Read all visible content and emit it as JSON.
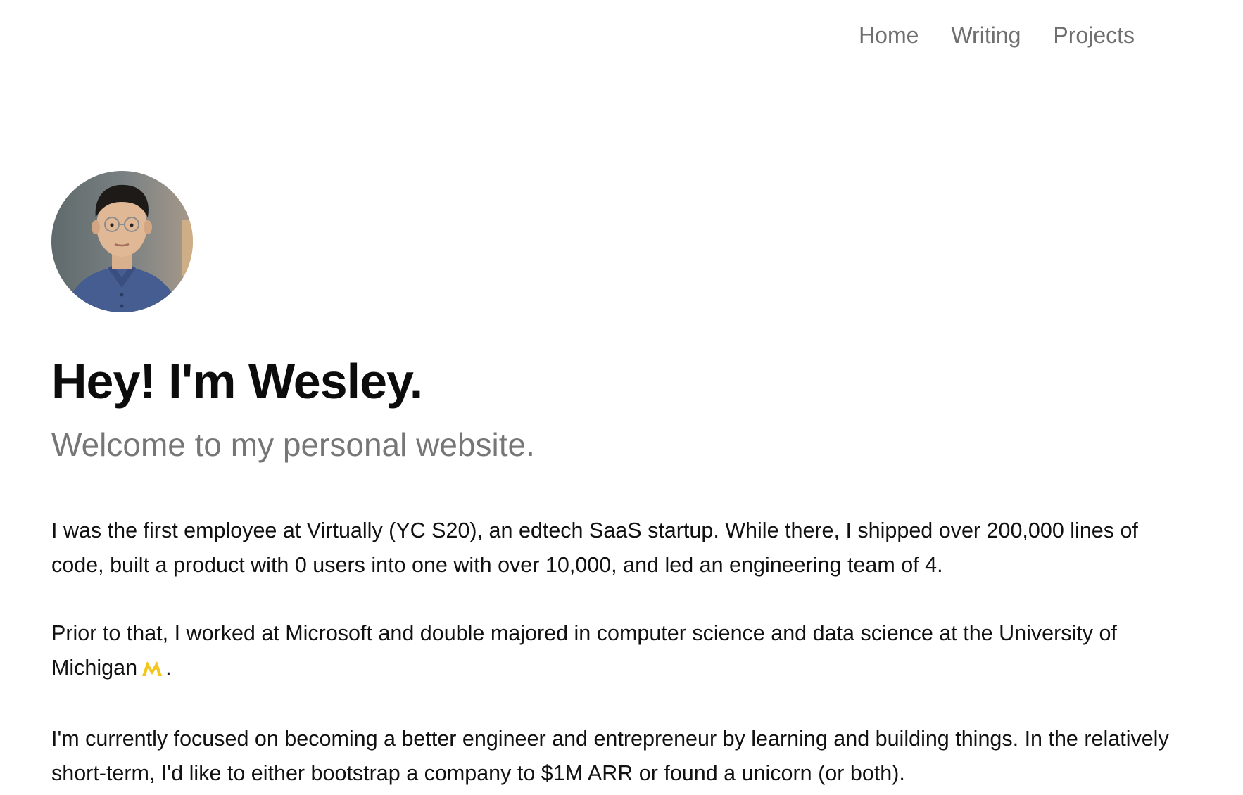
{
  "nav": {
    "items": [
      {
        "label": "Home"
      },
      {
        "label": "Writing"
      },
      {
        "label": "Projects"
      }
    ]
  },
  "hero": {
    "avatar_icon": "portrait-photo",
    "title": "Hey! I'm Wesley.",
    "subtitle": "Welcome to my personal website."
  },
  "bio": {
    "p1": "I was the first employee at Virtually (YC S20), an edtech SaaS startup. While there, I shipped over 200,000 lines of code, built a product with 0 users into one with over 10,000, and led an engineering team of 4.",
    "p2_before": "Prior to that, I worked at Microsoft and double majored in computer science and data science at the University of Michigan",
    "p2_icon": "michigan-m-icon",
    "p2_after": ".",
    "p3": "I'm currently focused on becoming a better engineer and entrepreneur by learning and building things. In the relatively short-term, I'd like to either bootstrap a company to $1M ARR or found a unicorn (or both)."
  },
  "colors": {
    "nav_text": "#6f6f6f",
    "subtitle": "#767676",
    "body_text": "#111111",
    "michigan_maize": "#f5c518"
  }
}
